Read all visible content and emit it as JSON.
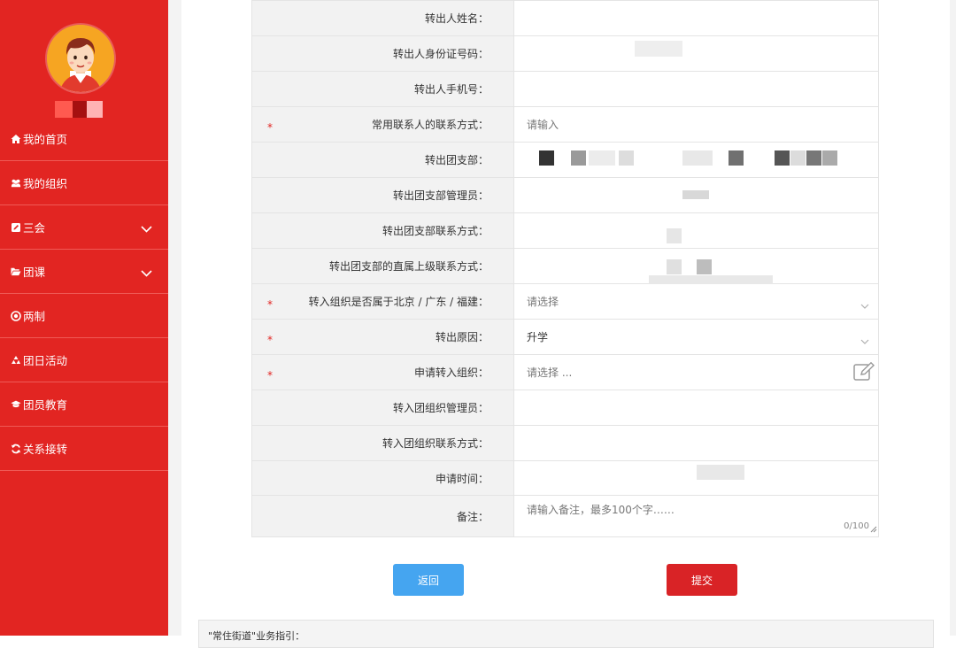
{
  "sidebar": {
    "user_name_colors": [
      "#ff5a50",
      "#a51010",
      "#ffb3b3"
    ],
    "items": [
      {
        "label": "我的首页",
        "icon": "home-icon",
        "has_chevron": false
      },
      {
        "label": "我的组织",
        "icon": "users-icon",
        "has_chevron": false
      },
      {
        "label": "三会",
        "icon": "edit-icon",
        "has_chevron": true
      },
      {
        "label": "团课",
        "icon": "folder-open-icon",
        "has_chevron": true
      },
      {
        "label": "两制",
        "icon": "target-icon",
        "has_chevron": false
      },
      {
        "label": "团日活动",
        "icon": "recycle-icon",
        "has_chevron": false
      },
      {
        "label": "团员教育",
        "icon": "graduation-cap-icon",
        "has_chevron": false
      },
      {
        "label": "关系接转",
        "icon": "refresh-icon",
        "has_chevron": false
      }
    ]
  },
  "form": {
    "rows": [
      {
        "label": "转出人姓名：",
        "required": false,
        "value": "",
        "placeholder": ""
      },
      {
        "label": "转出人身份证号码：",
        "required": false,
        "value": "",
        "placeholder": ""
      },
      {
        "label": "转出人手机号：",
        "required": false,
        "value": "",
        "placeholder": ""
      },
      {
        "label": "常用联系人的联系方式：",
        "required": true,
        "value": "",
        "placeholder": "请输入"
      },
      {
        "label": "转出团支部：",
        "required": false,
        "value": "",
        "placeholder": ""
      },
      {
        "label": "转出团支部管理员：",
        "required": false,
        "value": "",
        "placeholder": ""
      },
      {
        "label": "转出团支部联系方式：",
        "required": false,
        "value": "",
        "placeholder": ""
      },
      {
        "label": "转出团支部的直属上级联系方式：",
        "required": false,
        "value": "",
        "placeholder": ""
      },
      {
        "label": "转入组织是否属于北京 / 广东 / 福建：",
        "required": true,
        "value": "",
        "placeholder": "请选择",
        "type": "select"
      },
      {
        "label": "转出原因：",
        "required": true,
        "value": "升学",
        "placeholder": "",
        "type": "select"
      },
      {
        "label": "申请转入组织：",
        "required": true,
        "value": "",
        "placeholder": "请选择 ...",
        "type": "picker"
      },
      {
        "label": "转入团组织管理员：",
        "required": false,
        "value": "",
        "placeholder": ""
      },
      {
        "label": "转入团组织联系方式：",
        "required": false,
        "value": "",
        "placeholder": ""
      },
      {
        "label": "申请时间：",
        "required": false,
        "value": "",
        "placeholder": ""
      },
      {
        "label": "备注：",
        "required": false,
        "value": "",
        "placeholder": "请输入备注，最多100个字……",
        "type": "textarea",
        "counter": "0/100"
      }
    ],
    "required_mark": "*"
  },
  "buttons": {
    "back": "返回",
    "submit": "提交"
  },
  "guide": {
    "text": "\"常住街道\"业务指引："
  },
  "colors": {
    "sidebar": "#e22522",
    "back_button": "#45a5f0",
    "submit_button": "#d92326",
    "label_bg": "#f2f2f2"
  }
}
